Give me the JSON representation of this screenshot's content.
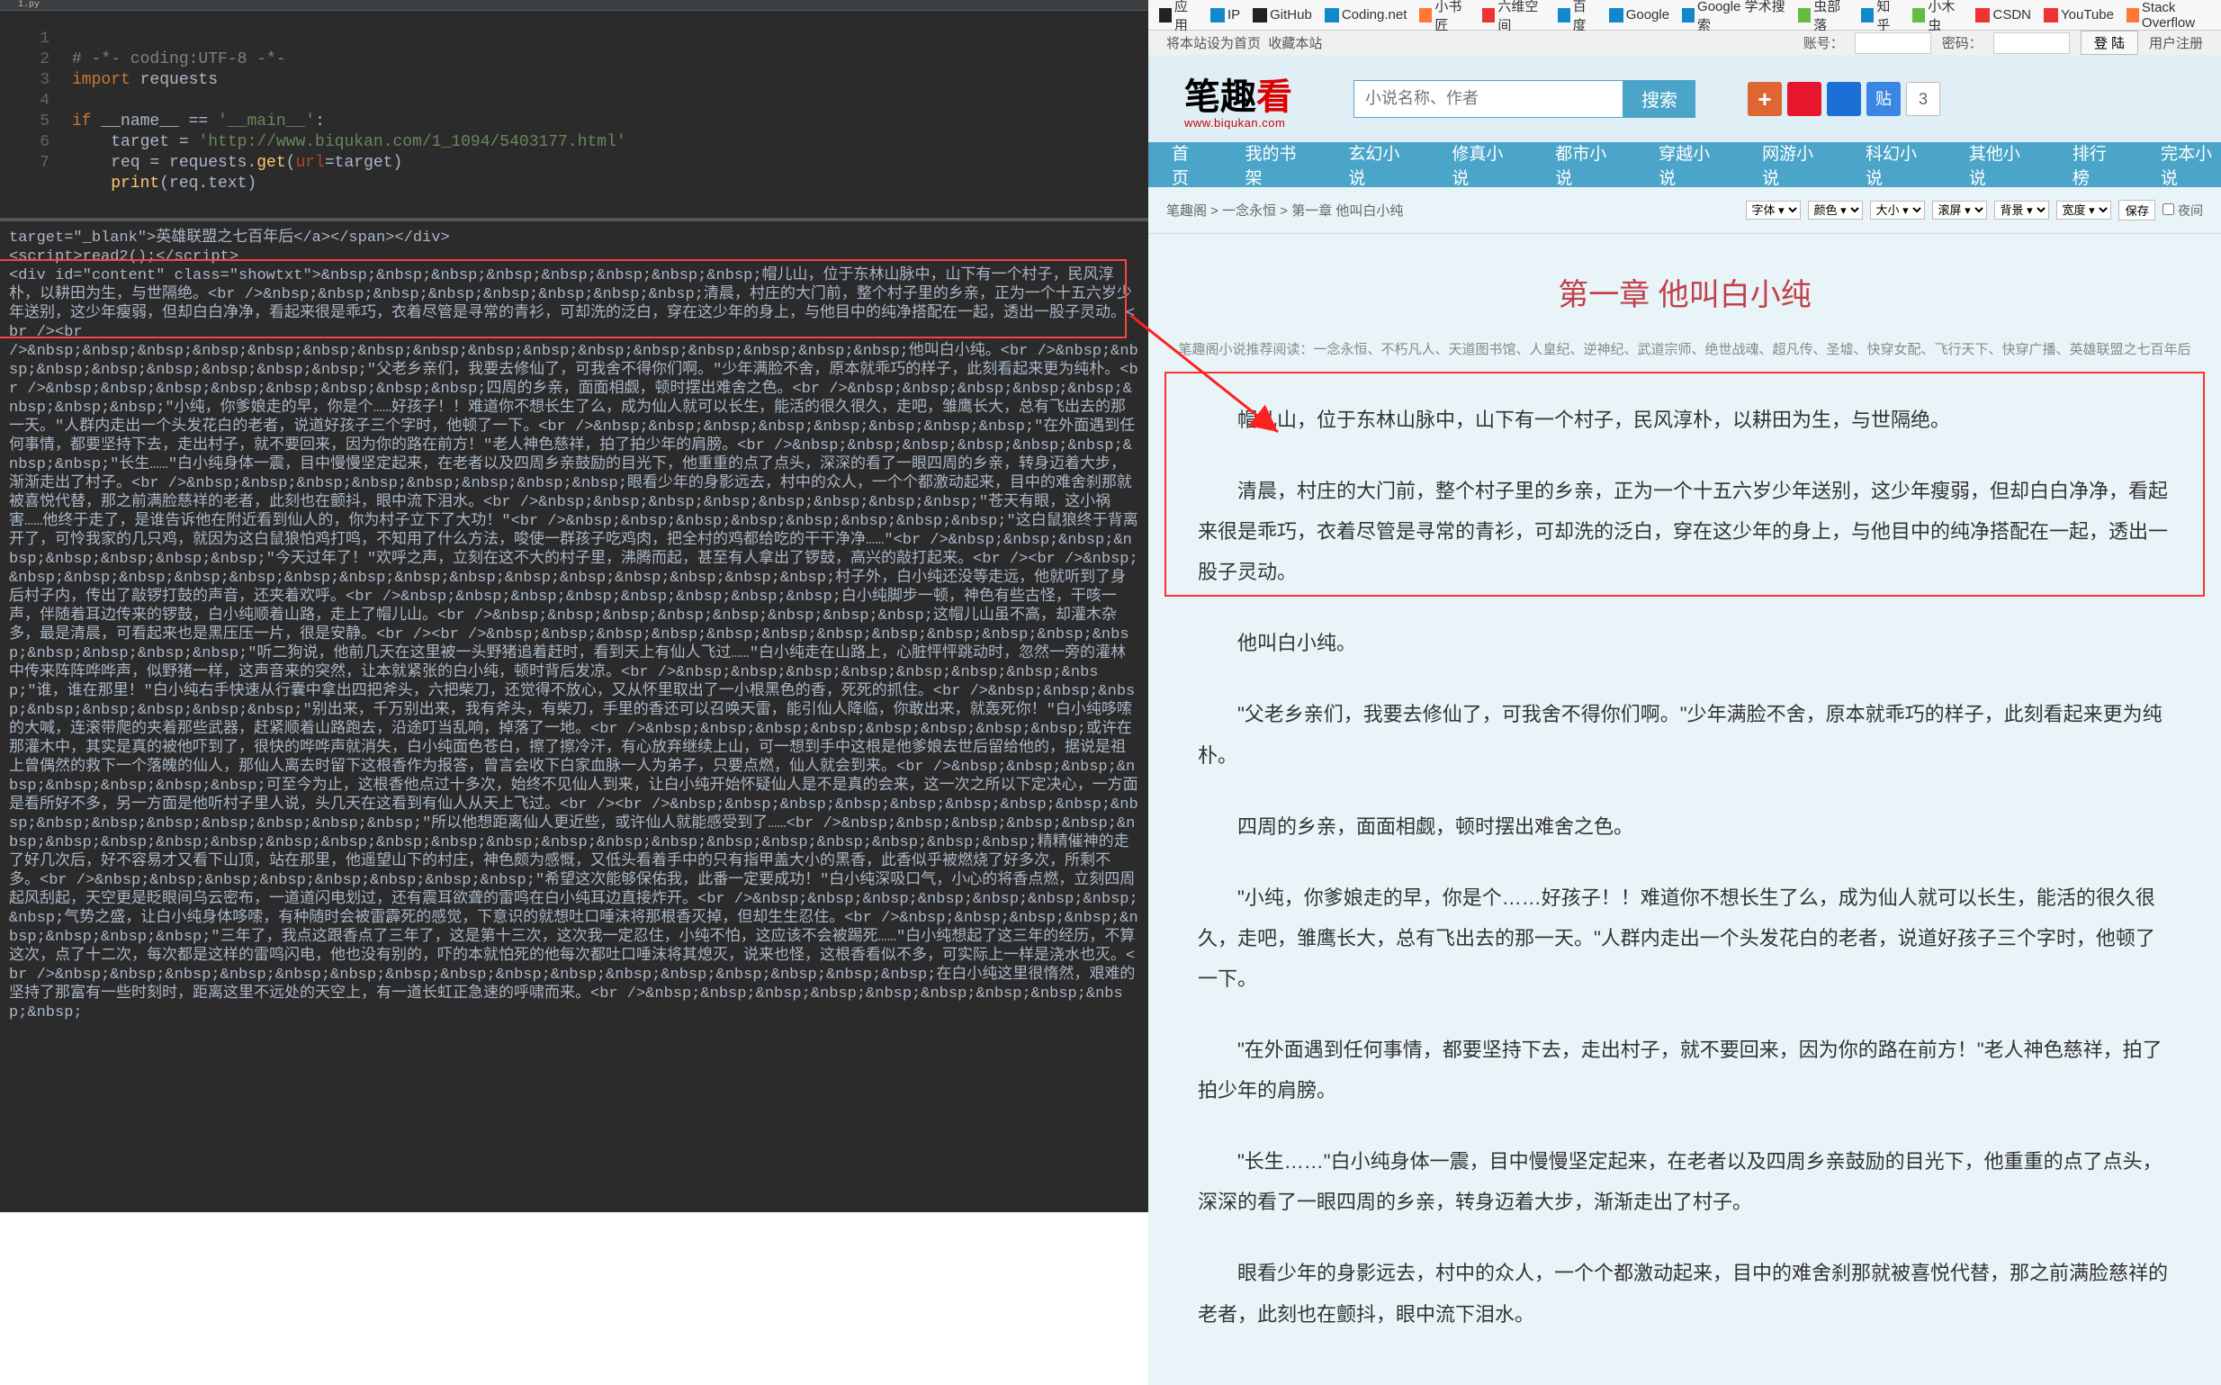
{
  "ide": {
    "tab": "1.py",
    "lines": [
      "1",
      "2",
      "3",
      "4",
      "5",
      "6",
      "7"
    ],
    "code": {
      "l1_comment": "# -*- coding:UTF-8 -*-",
      "l2_import": "import",
      "l2_mod": " requests",
      "l4_if": "if",
      "l4_expr": " __name__ == ",
      "l4_str": "'__main__'",
      "l4_colon": ":",
      "l5_var": "    target = ",
      "l5_url": "'http://www.biqukan.com/1_1094/5403177.html'",
      "l6_var": "    req = requests.",
      "l6_fn": "get",
      "l6_p1": "(",
      "l6_kw": "url",
      "l6_eq": "=target)",
      "l7_print": "    print",
      "l7_args": "(req.text)"
    },
    "output": {
      "l1": "target=\"_blank\">英雄联盟之七百年后</a></span></div>",
      "l2": "<script>read2();</script>",
      "hl": "<div id=\"content\" class=\"showtxt\">&nbsp;&nbsp;&nbsp;&nbsp;&nbsp;&nbsp;&nbsp;&nbsp;帽儿山，位于东林山脉中，山下有一个村子，民风淳朴，以耕田为生，与世隔绝。<br />&nbsp;&nbsp;&nbsp;&nbsp;&nbsp;&nbsp;&nbsp;&nbsp;清晨，村庄的大门前，整个村子里的乡亲，正为一个十五六岁少年送别，这少年瘦弱，但却白白净净，看起来很是乖巧，衣着尽管是寻常的青衫，可却洗的泛白，穿在这少年的身上，与他目中的纯净搭配在一起，透出一股子灵动。<br /><br ",
      "rest": "/>&nbsp;&nbsp;&nbsp;&nbsp;&nbsp;&nbsp;&nbsp;&nbsp;&nbsp;&nbsp;&nbsp;&nbsp;&nbsp;&nbsp;&nbsp;&nbsp;他叫白小纯。<br />&nbsp;&nbsp;&nbsp;&nbsp;&nbsp;&nbsp;&nbsp;&nbsp;\"父老乡亲们，我要去修仙了，可我舍不得你们啊。\"少年满脸不舍，原本就乖巧的样子，此刻看起来更为纯朴。<br />&nbsp;&nbsp;&nbsp;&nbsp;&nbsp;&nbsp;&nbsp;&nbsp;四周的乡亲，面面相觑，顿时摆出难舍之色。<br />&nbsp;&nbsp;&nbsp;&nbsp;&nbsp;&nbsp;&nbsp;&nbsp;\"小纯，你爹娘走的早，你是个……好孩子！！难道你不想长生了么，成为仙人就可以长生，能活的很久很久，走吧，雏鹰长大，总有飞出去的那一天。\"人群内走出一个头发花白的老者，说道好孩子三个字时，他顿了一下。<br />&nbsp;&nbsp;&nbsp;&nbsp;&nbsp;&nbsp;&nbsp;&nbsp;\"在外面遇到任何事情，都要坚持下去，走出村子，就不要回来，因为你的路在前方！\"老人神色慈祥，拍了拍少年的肩膀。<br />&nbsp;&nbsp;&nbsp;&nbsp;&nbsp;&nbsp;&nbsp;&nbsp;\"长生……\"白小纯身体一震，目中慢慢坚定起来，在老者以及四周乡亲鼓励的目光下，他重重的点了点头，深深的看了一眼四周的乡亲，转身迈着大步，渐渐走出了村子。<br />&nbsp;&nbsp;&nbsp;&nbsp;&nbsp;&nbsp;&nbsp;&nbsp;眼看少年的身影远去，村中的众人，一个个都激动起来，目中的难舍刹那就被喜悦代替，那之前满脸慈祥的老者，此刻也在颤抖，眼中流下泪水。<br />&nbsp;&nbsp;&nbsp;&nbsp;&nbsp;&nbsp;&nbsp;&nbsp;\"苍天有眼，这小祸害……他终于走了，是谁告诉他在附近看到仙人的，你为村子立下了大功！\"<br />&nbsp;&nbsp;&nbsp;&nbsp;&nbsp;&nbsp;&nbsp;&nbsp;\"这白鼠狼终于背离开了，可怜我家的几只鸡，就因为这白鼠狼怕鸡打鸣，不知用了什么方法，唆使一群孩子吃鸡肉，把全村的鸡都给吃的干干净净……\"<br />&nbsp;&nbsp;&nbsp;&nbsp;&nbsp;&nbsp;&nbsp;&nbsp;\"今天过年了！\"欢呼之声，立刻在这不大的村子里，沸腾而起，甚至有人拿出了锣鼓，高兴的敲打起来。<br /><br />&nbsp;&nbsp;&nbsp;&nbsp;&nbsp;&nbsp;&nbsp;&nbsp;&nbsp;&nbsp;&nbsp;&nbsp;&nbsp;&nbsp;&nbsp;&nbsp;村子外，白小纯还没等走远，他就听到了身后村子内，传出了敲锣打鼓的声音，还夹着欢呼。<br />&nbsp;&nbsp;&nbsp;&nbsp;&nbsp;&nbsp;&nbsp;&nbsp;白小纯脚步一顿，神色有些古怪，干咳一声，伴随着耳边传来的锣鼓，白小纯顺着山路，走上了帽儿山。<br />&nbsp;&nbsp;&nbsp;&nbsp;&nbsp;&nbsp;&nbsp;&nbsp;这帽儿山虽不高，却灌木杂多，最是清晨，可看起来也是黑压压一片，很是安静。<br /><br />&nbsp;&nbsp;&nbsp;&nbsp;&nbsp;&nbsp;&nbsp;&nbsp;&nbsp;&nbsp;&nbsp;&nbsp;&nbsp;&nbsp;&nbsp;&nbsp;\"听二狗说，他前几天在这里被一头野猪追着赶时，看到天上有仙人飞过……\"白小纯走在山路上，心脏怦怦跳动时，忽然一旁的灌林中传来阵阵哗哗声，似野猪一样，这声音来的突然，让本就紧张的白小纯，顿时背后发凉。<br />&nbsp;&nbsp;&nbsp;&nbsp;&nbsp;&nbsp;&nbsp;&nbsp;\"谁，谁在那里！\"白小纯右手快速从行囊中拿出四把斧头，六把柴刀，还觉得不放心，又从怀里取出了一小根黑色的香，死死的抓住。<br />&nbsp;&nbsp;&nbsp;&nbsp;&nbsp;&nbsp;&nbsp;&nbsp;\"别出来，千万别出来，我有斧头，有柴刀，手里的香还可以召唤天雷，能引仙人降临，你敢出来，就轰死你！\"白小纯哆嗦的大喊，连滚带爬的夹着那些武器，赶紧顺着山路跑去，沿途叮当乱响，掉落了一地。<br />&nbsp;&nbsp;&nbsp;&nbsp;&nbsp;&nbsp;&nbsp;&nbsp;或许在那灌木中，其实是真的被他吓到了，很快的哗哗声就消失，白小纯面色苍白，擦了擦冷汗，有心放弃继续上山，可一想到手中这根是他爹娘去世后留给他的，据说是祖上曾偶然的救下一个落魄的仙人，那仙人离去时留下这根香作为报答，曾言会收下白家血脉一人为弟子，只要点燃，仙人就会到来。<br />&nbsp;&nbsp;&nbsp;&nbsp;&nbsp;&nbsp;&nbsp;&nbsp;可至今为止，这根香他点过十多次，始终不见仙人到来，让白小纯开始怀疑仙人是不是真的会来，这一次之所以下定决心，一方面是看所好不多，另一方面是他听村子里人说，头几天在这看到有仙人从天上飞过。<br /><br />&nbsp;&nbsp;&nbsp;&nbsp;&nbsp;&nbsp;&nbsp;&nbsp;&nbsp;&nbsp;&nbsp;&nbsp;&nbsp;&nbsp;&nbsp;&nbsp;\"所以他想距离仙人更近些，或许仙人就能感受到了……<br />&nbsp;&nbsp;&nbsp;&nbsp;&nbsp;&nbsp;&nbsp;&nbsp;&nbsp;&nbsp;&nbsp;&nbsp;&nbsp;&nbsp;&nbsp;&nbsp;&nbsp;&nbsp;&nbsp;&nbsp;&nbsp;&nbsp;&nbsp;&nbsp;精精催神的走了好几次后，好不容易才又看下山顶，站在那里，他遥望山下的村庄，神色颇为感慨，又低头看着手中的只有指甲盖大小的黑香，此香似乎被燃烧了好多次，所剩不多。<br />&nbsp;&nbsp;&nbsp;&nbsp;&nbsp;&nbsp;&nbsp;&nbsp;\"希望这次能够保佑我，此番一定要成功！\"白小纯深吸口气，小心的将香点燃，立刻四周起风刮起，天空更是眨眼间乌云密布，一道道闪电划过，还有震耳欲聋的雷鸣在白小纯耳边直接炸开。<br />&nbsp;&nbsp;&nbsp;&nbsp;&nbsp;&nbsp;&nbsp;&nbsp;气势之盛，让白小纯身体哆嗦，有种随时会被雷霹死的感觉，下意识的就想吐口唾沫将那根香灭掉，但却生生忍住。<br />&nbsp;&nbsp;&nbsp;&nbsp;&nbsp;&nbsp;&nbsp;&nbsp;\"三年了，我点这跟香点了三年了，这是第十三次，这次我一定忍住，小纯不怕，这应该不会被踢死……\"白小纯想起了这三年的经历，不算这次，点了十二次，每次都是这样的雷鸣闪电，他也没有别的，吓的本就怕死的他每次都吐口唾沫将其熄灭，说来也怪，这根香看似不多，可实际上一样是浇水也灭。<br />&nbsp;&nbsp;&nbsp;&nbsp;&nbsp;&nbsp;&nbsp;&nbsp;&nbsp;&nbsp;&nbsp;&nbsp;&nbsp;&nbsp;&nbsp;&nbsp;在白小纯这里很惰然，艰难的坚持了那富有一些时刻时，距离这里不远处的天空上，有一道长虹正急速的呼啸而来。<br />&nbsp;&nbsp;&nbsp;&nbsp;&nbsp;&nbsp;&nbsp;&nbsp;&nbsp;&nbsp;"
    }
  },
  "bookmarks": [
    {
      "icon": "ico-blk",
      "label": "应用"
    },
    {
      "icon": "ico-blu",
      "label": "IP"
    },
    {
      "icon": "ico-blk",
      "label": "GitHub"
    },
    {
      "icon": "ico-blu",
      "label": "Coding.net"
    },
    {
      "icon": "ico-org",
      "label": "小书匠"
    },
    {
      "icon": "ico-red",
      "label": "六维空间"
    },
    {
      "icon": "ico-blu",
      "label": "百度"
    },
    {
      "icon": "ico-blu",
      "label": "Google"
    },
    {
      "icon": "ico-blu",
      "label": "Google 学术搜索"
    },
    {
      "icon": "ico-grn",
      "label": "虫部落"
    },
    {
      "icon": "ico-blu",
      "label": "知乎"
    },
    {
      "icon": "ico-grn",
      "label": "小木虫"
    },
    {
      "icon": "ico-red",
      "label": "CSDN"
    },
    {
      "icon": "ico-red",
      "label": "YouTube"
    },
    {
      "icon": "ico-org",
      "label": "Stack Overflow"
    }
  ],
  "user_bar": {
    "left1": "将本站设为首页",
    "left2": "收藏本站",
    "lbl_user": "账号：",
    "lbl_pass": "密码：",
    "btn_login": "登 陆",
    "btn_reg": "用户注册"
  },
  "logo": {
    "t1": "笔趣",
    "t2": "看",
    "sub": "www.biqukan.com"
  },
  "search": {
    "placeholder": "小说名称、作者",
    "btn": "搜索"
  },
  "share_count": "3",
  "nav": [
    "首页",
    "我的书架",
    "玄幻小说",
    "修真小说",
    "都市小说",
    "穿越小说",
    "网游小说",
    "科幻小说",
    "其他小说",
    "排行榜",
    "完本小说"
  ],
  "crumbs": "笔趣阁 > 一念永恒 > 第一章 他叫白小纯",
  "tools": {
    "font": "字体 ▾",
    "color": "颜色 ▾",
    "size": "大小 ▾",
    "scroll": "滚屏 ▾",
    "bg": "背景 ▾",
    "width": "宽度 ▾",
    "save": "保存",
    "night": "夜间"
  },
  "chapter": {
    "title": "第一章 他叫白小纯",
    "recommend": "笔趣阁小说推荐阅读：一念永恒、不朽凡人、天道图书馆、人皇纪、逆神纪、武道宗师、绝世战魂、超凡传、圣墟、快穿女配、飞行天下、快穿广播、英雄联盟之七百年后",
    "p1": "帽儿山，位于东林山脉中，山下有一个村子，民风淳朴，以耕田为生，与世隔绝。",
    "p2": "清晨，村庄的大门前，整个村子里的乡亲，正为一个十五六岁少年送别，这少年瘦弱，但却白白净净，看起来很是乖巧，衣着尽管是寻常的青衫，可却洗的泛白，穿在这少年的身上，与他目中的纯净搭配在一起，透出一股子灵动。",
    "p3": "他叫白小纯。",
    "p4": "\"父老乡亲们，我要去修仙了，可我舍不得你们啊。\"少年满脸不舍，原本就乖巧的样子，此刻看起来更为纯朴。",
    "p5": "四周的乡亲，面面相觑，顿时摆出难舍之色。",
    "p6": "\"小纯，你爹娘走的早，你是个……好孩子！！难道你不想长生了么，成为仙人就可以长生，能活的很久很久，走吧，雏鹰长大，总有飞出去的那一天。\"人群内走出一个头发花白的老者，说道好孩子三个字时，他顿了一下。",
    "p7": "\"在外面遇到任何事情，都要坚持下去，走出村子，就不要回来，因为你的路在前方！\"老人神色慈祥，拍了拍少年的肩膀。",
    "p8": "\"长生……\"白小纯身体一震，目中慢慢坚定起来，在老者以及四周乡亲鼓励的目光下，他重重的点了点头，深深的看了一眼四周的乡亲，转身迈着大步，渐渐走出了村子。",
    "p9": "眼看少年的身影远去，村中的众人，一个个都激动起来，目中的难舍刹那就被喜悦代替，那之前满脸慈祥的老者，此刻也在颤抖，眼中流下泪水。"
  }
}
